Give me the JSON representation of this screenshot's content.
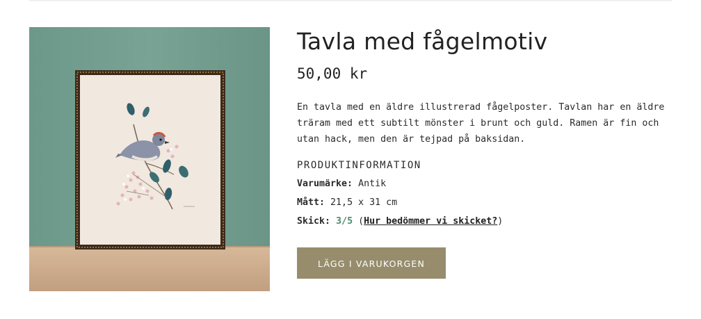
{
  "product": {
    "title": "Tavla med fågelmotiv",
    "price": "50,00 kr",
    "description": "En tavla med en äldre illustrerad fågelposter. Tavlan har en äldre träram med ett subtilt mönster i brunt och guld. Ramen är fin och utan hack, men den är tejpad på baksidan.",
    "image_alt": "Inramad tavla med fågelmotiv"
  },
  "info": {
    "heading": "PRODUKTINFORMATION",
    "brand_label": "Varumärke:",
    "brand_value": "Antik",
    "size_label": "Mått:",
    "size_value": "21,5 x 31 cm",
    "condition_label": "Skick:",
    "condition_value": "3/5",
    "condition_open": "(",
    "condition_link": "Hur bedömmer vi skicket?",
    "condition_close": ")"
  },
  "actions": {
    "add_to_cart": "LÄGG I VARUKORGEN"
  },
  "colors": {
    "button_bg": "#978d6c",
    "grade": "#4f8a6b",
    "wall": "#739d8e",
    "shelf": "#c9a98a"
  }
}
